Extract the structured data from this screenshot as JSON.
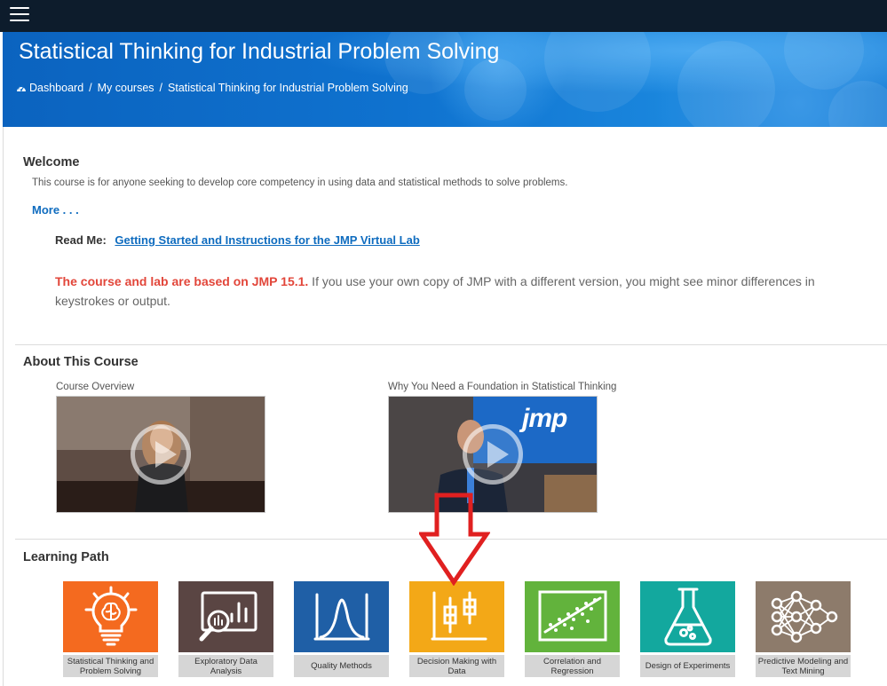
{
  "header": {
    "menu_icon": "hamburger-menu-icon",
    "course_title": "Statistical Thinking for Industrial Problem Solving",
    "breadcrumb": {
      "icon": "dashboard-icon",
      "items": [
        "Dashboard",
        "My courses",
        "Statistical Thinking for Industrial Problem Solving"
      ],
      "separator": "/"
    }
  },
  "welcome": {
    "title": "Welcome",
    "intro": "This course is for anyone seeking to develop core competency in using data and statistical methods to solve problems.",
    "more_link": "More . . .",
    "readme_label": "Read Me:",
    "readme_link": "Getting Started and Instructions for the JMP Virtual Lab",
    "notice_bold": "The course and lab are based on JMP 15.1.",
    "notice_rest": " If you use your own copy of JMP with a different version, you might see minor differences in keystrokes or output."
  },
  "about": {
    "title": "About This Course",
    "videos": [
      {
        "caption": "Course Overview",
        "icon": "play-icon"
      },
      {
        "caption": "Why You Need a Foundation in Statistical Thinking",
        "icon": "play-icon",
        "logo_text": "jmp"
      }
    ]
  },
  "learning_path": {
    "title": "Learning Path",
    "modules": [
      {
        "label": "Statistical Thinking and Problem Solving",
        "icon": "lightbulb-brain-icon",
        "color": "#f46a1f"
      },
      {
        "label": "Exploratory Data Analysis",
        "icon": "magnified-bar-chart-icon",
        "color": "#5a4543"
      },
      {
        "label": "Quality Methods",
        "icon": "bell-curve-icon",
        "color": "#1f5fa6"
      },
      {
        "label": "Decision Making with Data",
        "icon": "box-plot-icon",
        "color": "#f3a817"
      },
      {
        "label": "Correlation and Regression",
        "icon": "scatter-regression-icon",
        "color": "#62b33c"
      },
      {
        "label": "Design of Experiments",
        "icon": "flask-icon",
        "color": "#13a89e"
      },
      {
        "label": "Predictive Modeling and Text Mining",
        "icon": "neural-network-icon",
        "color": "#8d7b6b"
      }
    ]
  },
  "annotation": {
    "arrow_color": "#e02020",
    "arrow_icon": "down-arrow-annotation-icon"
  }
}
